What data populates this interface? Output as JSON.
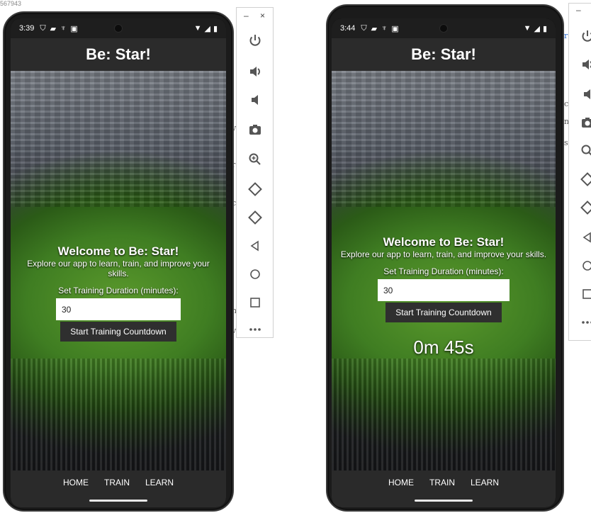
{
  "background": {
    "top_fragment": "567943",
    "letters": [
      "y",
      "r",
      "c",
      "n",
      "v"
    ],
    "right_letters": [
      "r",
      "c",
      "n",
      "s"
    ]
  },
  "emulator_panel": {
    "minimize": "–",
    "close": "×",
    "buttons": [
      "power-icon",
      "volume-up-icon",
      "volume-down-icon",
      "camera-icon",
      "zoom-icon",
      "rotate-left-icon",
      "rotate-right-icon",
      "back-icon",
      "home-icon",
      "overview-icon",
      "more-icon"
    ]
  },
  "phones": [
    {
      "status": {
        "time": "3:39"
      },
      "app_title": "Be: Star!",
      "welcome_title": "Welcome to Be: Star!",
      "welcome_text": "Explore our app to learn, train, and improve your skills.",
      "duration_label": "Set Training Duration (minutes):",
      "duration_value": "30",
      "start_button": "Start Training Countdown",
      "timer": "",
      "nav": [
        "HOME",
        "TRAIN",
        "LEARN"
      ]
    },
    {
      "status": {
        "time": "3:44"
      },
      "app_title": "Be: Star!",
      "welcome_title": "Welcome to Be: Star!",
      "welcome_text": "Explore our app to learn, train, and improve your skills.",
      "duration_label": "Set Training Duration (minutes):",
      "duration_value": "30",
      "start_button": "Start Training Countdown",
      "timer": "0m 45s",
      "nav": [
        "HOME",
        "TRAIN",
        "LEARN"
      ]
    }
  ]
}
